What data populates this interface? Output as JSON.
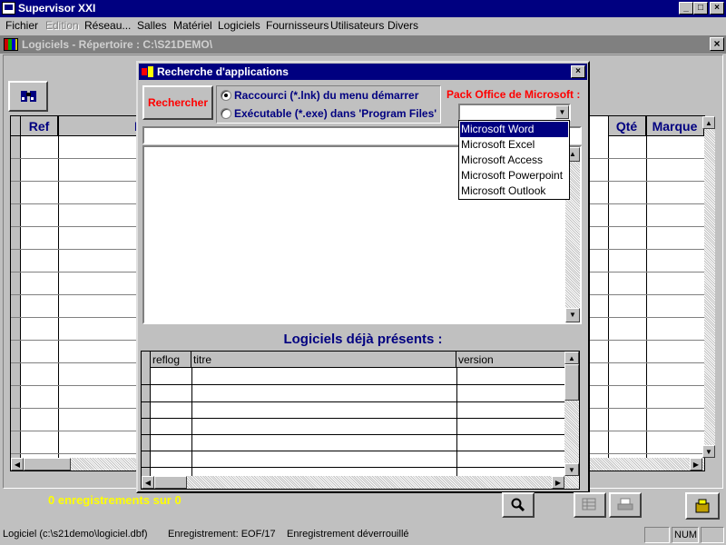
{
  "app": {
    "title": "Supervisor XXI",
    "window_buttons": {
      "minimize": "_",
      "maximize": "□",
      "close": "×"
    }
  },
  "menu": [
    {
      "label": "Fichier",
      "enabled": true
    },
    {
      "label": "Edition",
      "enabled": false
    },
    {
      "label": "Réseau...",
      "enabled": true
    },
    {
      "label": "Salles",
      "enabled": true
    },
    {
      "label": "Matériel",
      "enabled": true
    },
    {
      "label": "Logiciels",
      "enabled": true
    },
    {
      "label": "Fournisseurs",
      "enabled": true
    },
    {
      "label": "Utilisateurs",
      "enabled": true
    },
    {
      "label": "Divers",
      "enabled": true
    }
  ],
  "child_window": {
    "title": "Logiciels - Répertoire : C:\\S21DEMO\\",
    "close_glyph": "×"
  },
  "grid": {
    "headers": {
      "ref": "Ref",
      "col2": "L",
      "qte": "Qté",
      "marque": "Marque"
    }
  },
  "dialog": {
    "title": "Recherche d'applications",
    "close_glyph": "×",
    "search_button": "Rechercher",
    "radio_lnk": "Raccourci (*.lnk) du menu démarrer",
    "radio_exe": "Exécutable (*.exe) dans 'Program Files'",
    "pack_label": "Pack Office de Microsoft :",
    "dropdown_value": "",
    "dropdown_options": [
      "Microsoft Word",
      "Microsoft Excel",
      "Microsoft Access",
      "Microsoft Powerpoint",
      "Microsoft Outlook"
    ],
    "dropdown_selected_index": 0,
    "path_input_value": "",
    "existing_heading": "Logiciels déjà présents :",
    "existing_columns": [
      "reflog",
      "titre",
      "version"
    ]
  },
  "count_text": "0  enregistrements sur  0",
  "status": {
    "file": "Logiciel (c:\\s21demo\\logiciel.dbf)",
    "record": "Enregistrement: EOF/17",
    "lock": "Enregistrement déverrouillé",
    "num": "NUM"
  },
  "colors": {
    "title_bar": "#000080",
    "count_text": "#ffff00",
    "label_blue": "#000080",
    "label_red": "#ff0000"
  },
  "icons": [
    "app-icon",
    "binoculars-icon",
    "magnifier-icon",
    "grid-icon",
    "printer-icon",
    "exit-icon",
    "dialog-icon",
    "dropdown-arrow-icon",
    "scroll-arrow-icons"
  ]
}
